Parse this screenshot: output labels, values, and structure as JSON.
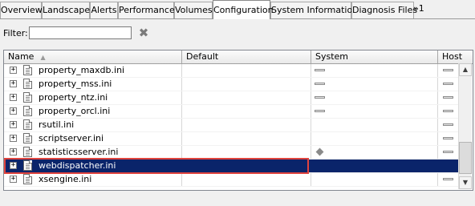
{
  "tabs": [
    {
      "label": "Overview",
      "active": false
    },
    {
      "label": "Landscape",
      "active": false
    },
    {
      "label": "Alerts",
      "active": false
    },
    {
      "label": "Performance",
      "active": false
    },
    {
      "label": "Volumes",
      "active": false
    },
    {
      "label": "Configuration",
      "active": true
    },
    {
      "label": "System Information",
      "active": false
    },
    {
      "label": "Diagnosis Files",
      "active": false
    }
  ],
  "tab_overflow": "»1",
  "filter": {
    "label": "Filter:",
    "value": "",
    "placeholder": ""
  },
  "icons": {
    "clear": "clear-x-icon",
    "file": "ini-file-icon",
    "expand": "expand-plus-icon",
    "sort": "sort-ascending-icon"
  },
  "columns": [
    "Name",
    "Default",
    "System",
    "Host"
  ],
  "rows": [
    {
      "name": "property_maxdb.ini",
      "system": "dash",
      "host": "dash"
    },
    {
      "name": "property_mss.ini",
      "system": "dash",
      "host": "dash"
    },
    {
      "name": "property_ntz.ini",
      "system": "dash",
      "host": "dash"
    },
    {
      "name": "property_orcl.ini",
      "system": "dash",
      "host": "dash"
    },
    {
      "name": "rsutil.ini",
      "system": "",
      "host": "dash"
    },
    {
      "name": "scriptserver.ini",
      "system": "",
      "host": "dash"
    },
    {
      "name": "statisticsserver.ini",
      "system": "diamond",
      "host": "dash"
    },
    {
      "name": "webdispatcher.ini",
      "system": "",
      "host": "",
      "selected": true
    },
    {
      "name": "xsengine.ini",
      "system": "",
      "host": "dash"
    }
  ],
  "colors": {
    "selection": "#0a246a",
    "highlight_border": "#e0443e"
  }
}
